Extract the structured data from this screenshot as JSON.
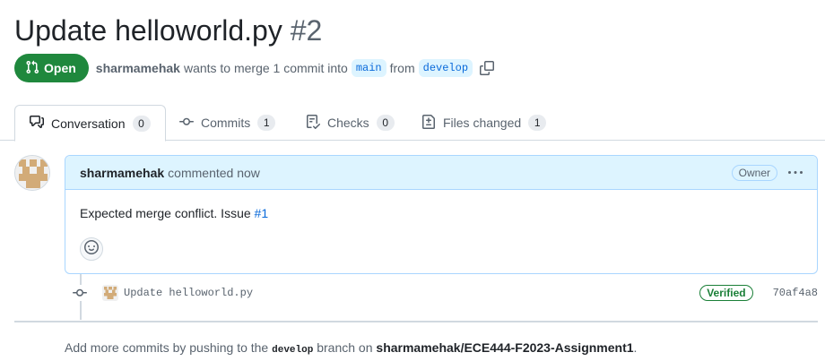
{
  "pr": {
    "title": "Update helloworld.py",
    "number": "#2",
    "state": "Open",
    "author": "sharmamehak",
    "merge_text": "wants to merge 1 commit into",
    "base_branch": "main",
    "from_text": "from",
    "head_branch": "develop"
  },
  "tabs": [
    {
      "label": "Conversation",
      "count": "0",
      "icon": "comment-discussion-icon"
    },
    {
      "label": "Commits",
      "count": "1",
      "icon": "git-commit-icon"
    },
    {
      "label": "Checks",
      "count": "0",
      "icon": "checklist-icon"
    },
    {
      "label": "Files changed",
      "count": "1",
      "icon": "file-diff-icon"
    }
  ],
  "comment": {
    "author": "sharmamehak",
    "time": "commented now",
    "role": "Owner",
    "body_text": "Expected merge conflict. Issue",
    "issue_link": "#1"
  },
  "commit": {
    "message": "Update helloworld.py",
    "verified": "Verified",
    "sha": "70af4a8"
  },
  "footer": {
    "prefix": "Add more commits by pushing to the",
    "branch": "develop",
    "middle": "branch on",
    "repo": "sharmamehak/ECE444-F2023-Assignment1",
    "suffix": "."
  },
  "colors": {
    "open_green": "#1f883d",
    "link_blue": "#0969da",
    "comment_header_bg": "#ddf4ff",
    "avatar_tan": "#d2ab78"
  }
}
